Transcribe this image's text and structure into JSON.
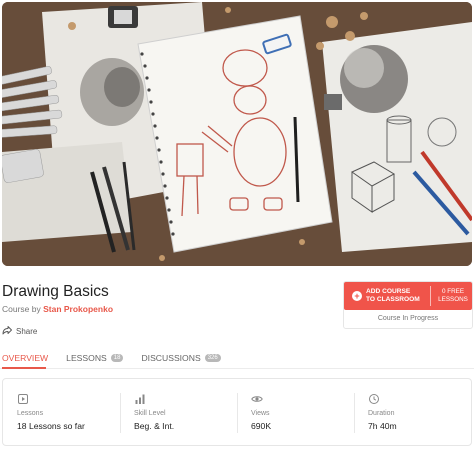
{
  "hero": {
    "alt": "Drawing Basics course cover"
  },
  "course": {
    "title": "Drawing Basics",
    "by_prefix": "Course by ",
    "author": "Stan Prokopenko",
    "share_label": "Share"
  },
  "enroll": {
    "button_line1": "ADD COURSE",
    "button_line2": "TO CLASSROOM",
    "free_line1": "0 FREE",
    "free_line2": "LESSONS",
    "status": "Course In Progress"
  },
  "tabs": [
    {
      "label": "OVERVIEW",
      "badge": ""
    },
    {
      "label": "LESSONS",
      "badge": "18"
    },
    {
      "label": "DISCUSSIONS",
      "badge": "326"
    }
  ],
  "stats": [
    {
      "icon": "play-icon",
      "label": "Lessons",
      "value": "18 Lessons so far"
    },
    {
      "icon": "bar-chart-icon",
      "label": "Skill Level",
      "value": "Beg. & Int."
    },
    {
      "icon": "eye-icon",
      "label": "Views",
      "value": "690K"
    },
    {
      "icon": "clock-icon",
      "label": "Duration",
      "value": "7h 40m"
    }
  ],
  "colors": {
    "accent": "#f0544a",
    "accent_text": "#e8584a"
  }
}
